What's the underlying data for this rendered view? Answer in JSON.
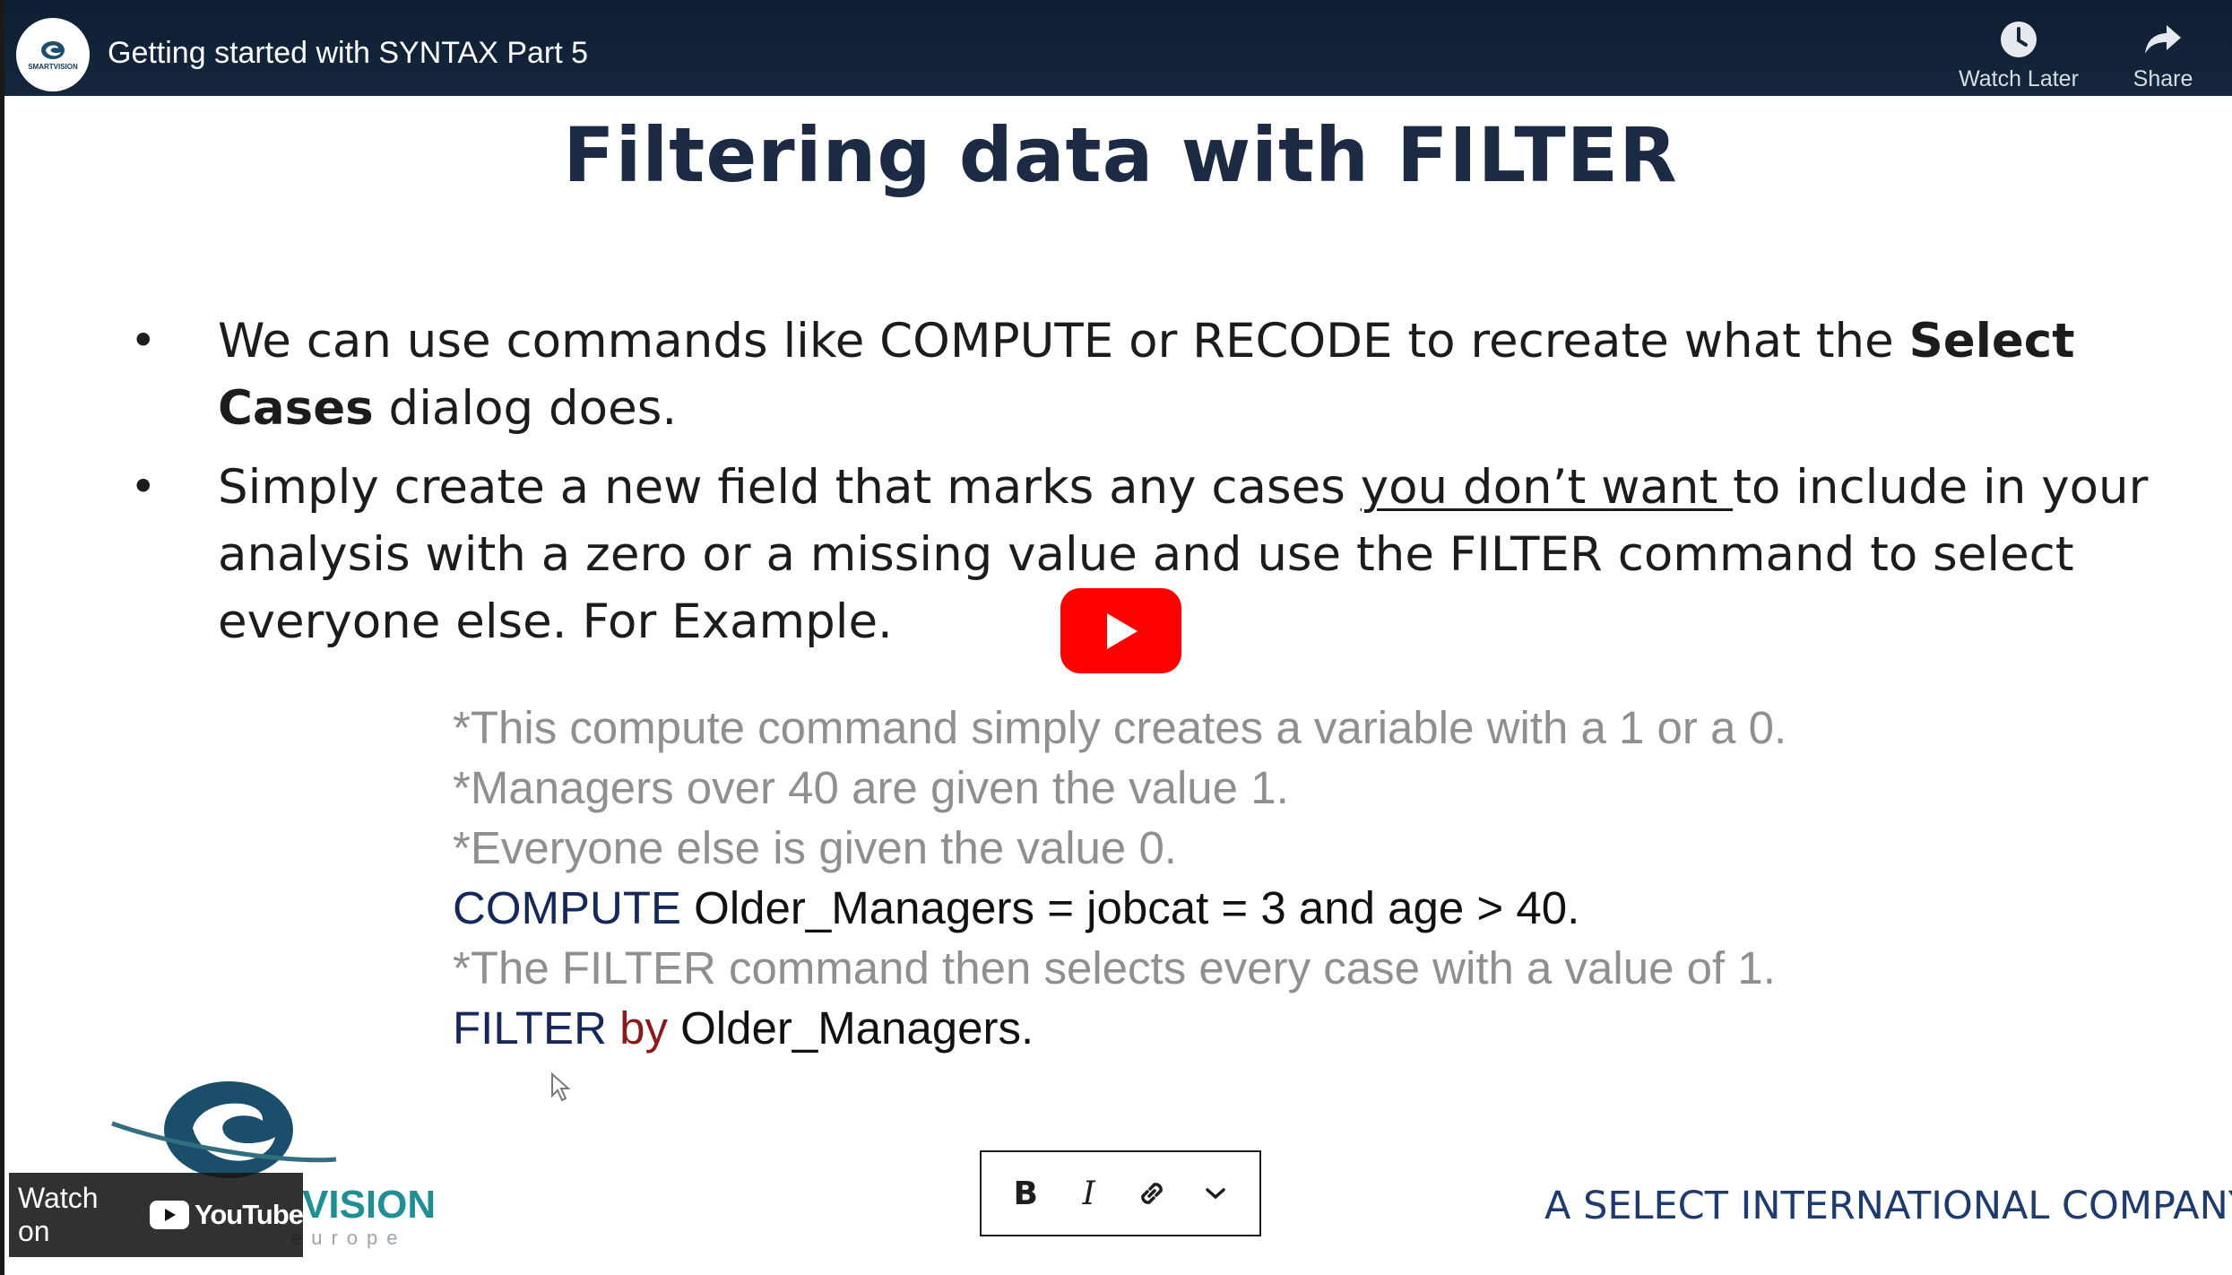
{
  "app": {
    "video_title": "Getting started with SYNTAX Part 5",
    "channel_avatar_text": "SMARTVISION"
  },
  "top_actions": {
    "watch_later_label": "Watch Later",
    "share_label": "Share"
  },
  "slide": {
    "title": "Filtering data with FILTER",
    "bullet_glyph": "•",
    "bullet1": {
      "text_a": "We can use commands like COMPUTE or RECODE to recreate what the ",
      "bold": "Select Cases",
      "text_b": " dialog does."
    },
    "bullet2": {
      "text_a": "Simply create a new field that marks any cases ",
      "underlined": "you don’t want ",
      "text_b": "to include in your analysis with a zero or a missing value and use the FILTER command to select everyone else. For Example."
    },
    "code": {
      "comment1": "*This compute command simply creates a variable with a 1 or a 0.",
      "comment2": "*Managers over 40 are given the value 1.",
      "comment3": "*Everyone else is given the value 0.",
      "compute_kw": "COMPUTE",
      "compute_expr": " Older_Managers = jobcat = 3 and age > 40.",
      "comment4": "*The FILTER command then selects every case with a value of 1.",
      "filter_kw": "FILTER",
      "filter_by": "by",
      "filter_expr": "Older_Managers."
    },
    "company_tagline": "A SELECT INTERNATIONAL COMPANY",
    "logo_text": "VISION",
    "logo_subtext": "europe"
  },
  "youtube": {
    "watch_on_label": "Watch on",
    "brand": "YouTube"
  },
  "format_toolbar": {
    "bold_label": "B",
    "italic_label": "I"
  },
  "colors": {
    "topbar": "#14263d",
    "play_red": "#ff0000",
    "title_navy": "#1d2a44",
    "comment_gray": "#8f8f8f",
    "keyword_navy": "#16275a",
    "keyword_red": "#8b1a1a",
    "company_blue": "#1e3a6e",
    "logo_teal": "#1f8f94"
  }
}
